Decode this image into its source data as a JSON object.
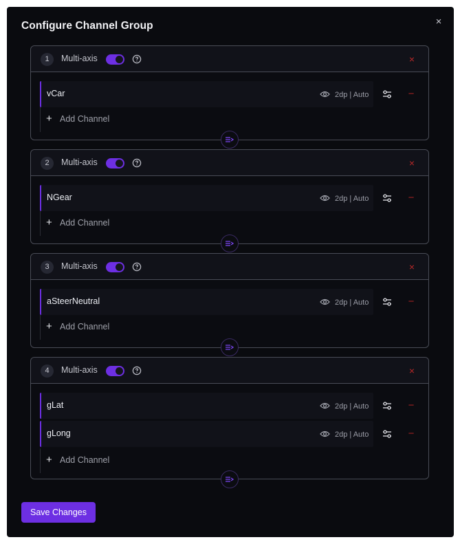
{
  "modal": {
    "title": "Configure Channel Group",
    "close_label": "×"
  },
  "colors": {
    "accent": "#6d2fe3",
    "danger": "#b72828",
    "background": "#0a0b0f"
  },
  "groups": [
    {
      "number": "1",
      "label": "Multi-axis",
      "multi_axis_on": true,
      "remove_label": "×",
      "channels": [
        {
          "name": "vCar",
          "format": "2dp | Auto",
          "remove_label": "−"
        }
      ],
      "add_label": "Add Channel"
    },
    {
      "number": "2",
      "label": "Multi-axis",
      "multi_axis_on": true,
      "remove_label": "×",
      "channels": [
        {
          "name": "NGear",
          "format": "2dp | Auto",
          "remove_label": "−"
        }
      ],
      "add_label": "Add Channel"
    },
    {
      "number": "3",
      "label": "Multi-axis",
      "multi_axis_on": true,
      "remove_label": "×",
      "channels": [
        {
          "name": "aSteerNeutral",
          "format": "2dp | Auto",
          "remove_label": "−"
        }
      ],
      "add_label": "Add Channel"
    },
    {
      "number": "4",
      "label": "Multi-axis",
      "multi_axis_on": true,
      "remove_label": "×",
      "channels": [
        {
          "name": "gLat",
          "format": "2dp | Auto",
          "remove_label": "−"
        },
        {
          "name": "gLong",
          "format": "2dp | Auto",
          "remove_label": "−"
        }
      ],
      "add_label": "Add Channel"
    }
  ],
  "icons": {
    "help": "help-circle-icon",
    "eye": "eye-icon",
    "settings": "sliders-icon",
    "grip": "reorder-icon",
    "add": "plus-icon"
  },
  "footer": {
    "save_label": "Save Changes"
  }
}
